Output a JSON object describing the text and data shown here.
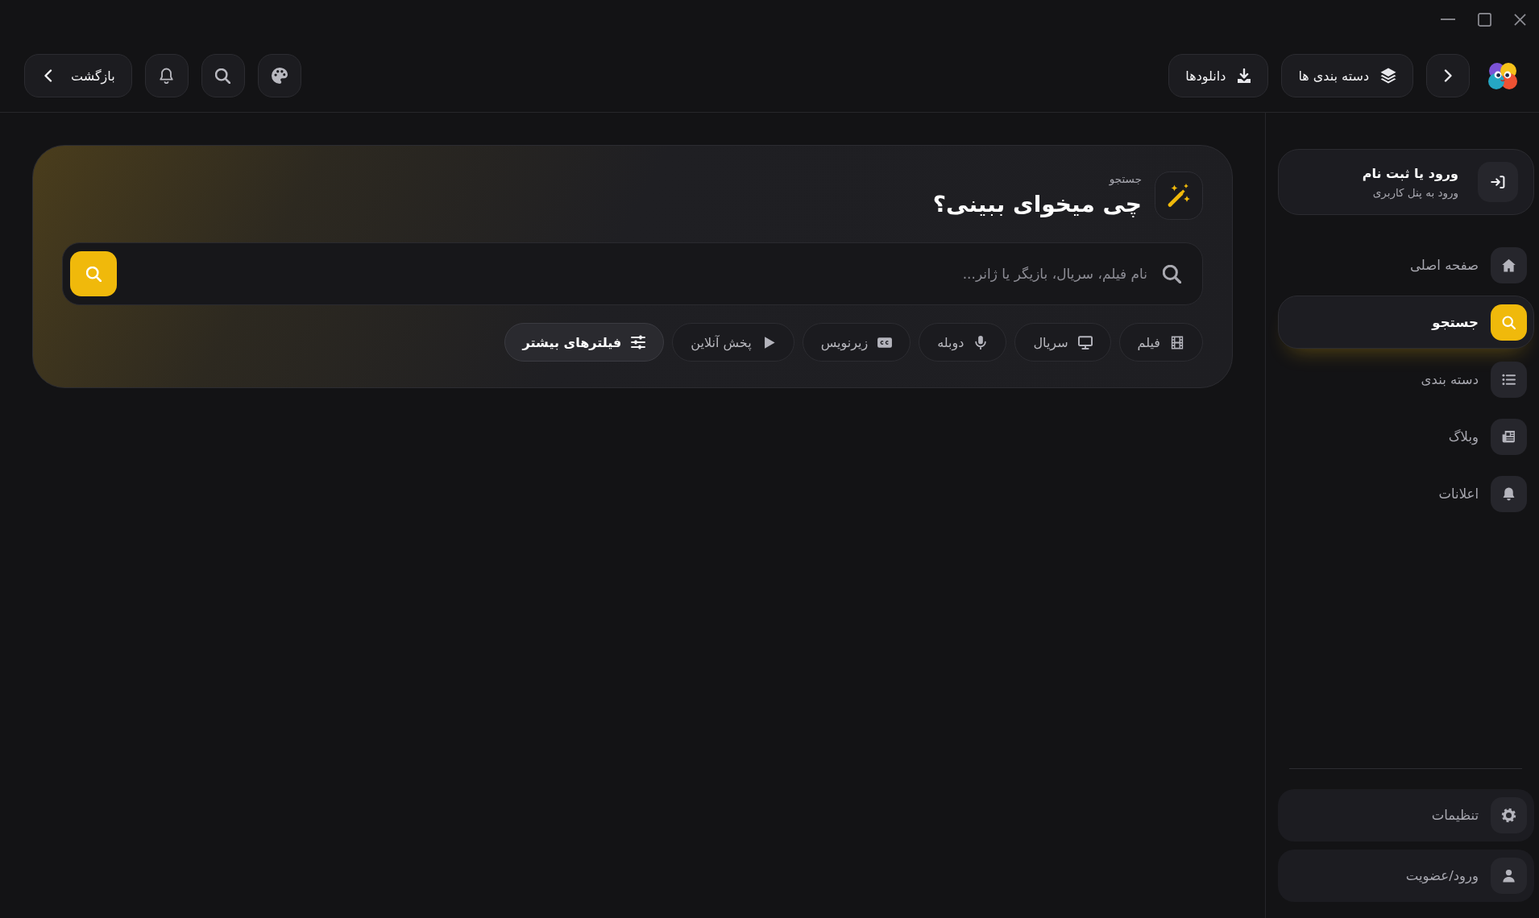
{
  "header": {
    "back_button": {
      "label": "بازگشت"
    },
    "categories_button": {
      "label": "دسته بندی ها"
    },
    "downloads_button": {
      "label": "دانلودها"
    }
  },
  "search_panel": {
    "eyebrow": "جستجو",
    "title": "چی میخوای ببینی؟",
    "search_field": {
      "placeholder": "نام فیلم، سریال، بازیگر یا ژانر..."
    },
    "filters": [
      {
        "label": "فیلم",
        "selected": false
      },
      {
        "label": "سریال",
        "selected": false
      },
      {
        "label": "دوبله",
        "selected": false
      },
      {
        "label": "زیرنویس",
        "selected": false
      },
      {
        "label": "پخش آنلاین",
        "selected": false
      }
    ],
    "more_filters_button": {
      "label": "فیلترهای بیشتر"
    }
  },
  "sidebar": {
    "account_card": {
      "title": "ورود یا ثبت نام",
      "subtitle": "ورود به پنل کاربری"
    },
    "items": [
      {
        "label": "صفحه اصلی",
        "selected": false
      },
      {
        "label": "جستجو",
        "selected": true
      },
      {
        "label": "دسته بندی",
        "selected": false
      },
      {
        "label": "وبلاگ",
        "selected": false
      },
      {
        "label": "اعلانات",
        "selected": false
      }
    ],
    "footer_items": [
      {
        "label": "تنظیمات"
      },
      {
        "label": "ورود/عضویت"
      }
    ]
  }
}
